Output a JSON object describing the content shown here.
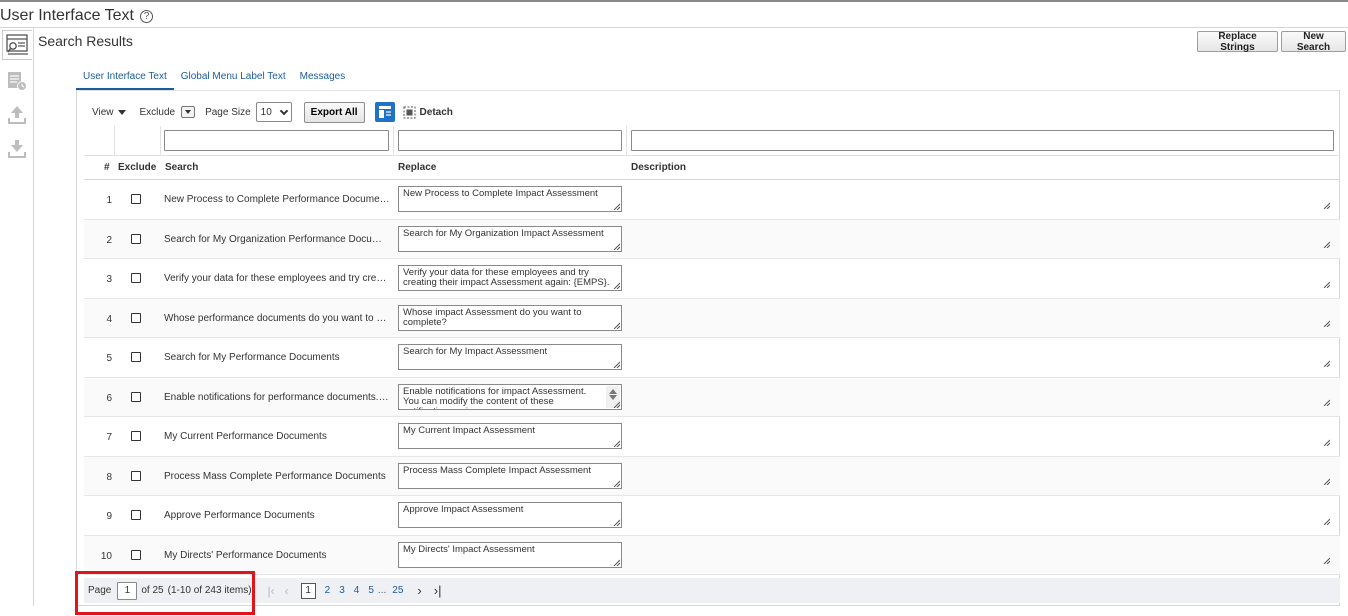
{
  "page": {
    "title": "User Interface Text",
    "section_title": "Search Results"
  },
  "actions": {
    "replace_strings": "Replace Strings",
    "new_search": "New Search"
  },
  "tabs": [
    {
      "label": "User Interface Text",
      "active": true
    },
    {
      "label": "Global Menu Label Text",
      "active": false
    },
    {
      "label": "Messages",
      "active": false
    }
  ],
  "toolbar": {
    "view": "View",
    "exclude": "Exclude",
    "page_size_label": "Page Size",
    "page_size_value": "10",
    "export_all": "Export All",
    "detach": "Detach"
  },
  "columns": {
    "num": "#",
    "exclude": "Exclude",
    "search": "Search",
    "replace": "Replace",
    "description": "Description"
  },
  "rows": [
    {
      "num": "1",
      "search": "New Process to Complete Performance Documents",
      "replace": "New Process to Complete Impact Assessment"
    },
    {
      "num": "2",
      "search": "Search for My Organization Performance Documents",
      "replace": "Search for My Organization Impact Assessment"
    },
    {
      "num": "3",
      "search": "Verify your data for these employees and try creating t...",
      "replace": "Verify your data for these employees and try creating their impact Assessment again: {EMPS}."
    },
    {
      "num": "4",
      "search": "Whose performance documents do you want to compl...",
      "replace": "Whose impact Assessment do you want to complete?"
    },
    {
      "num": "5",
      "search": "Search for My Performance Documents",
      "replace": "Search for My Impact Assessment"
    },
    {
      "num": "6",
      "search": "Enable notifications for performance documents. You ...",
      "replace": "Enable notifications for impact Assessment. You can modify the content of these notifications using"
    },
    {
      "num": "7",
      "search": "My Current Performance Documents",
      "replace": "My Current Impact Assessment"
    },
    {
      "num": "8",
      "search": "Process Mass Complete Performance Documents",
      "replace": "Process Mass Complete Impact Assessment"
    },
    {
      "num": "9",
      "search": "Approve Performance Documents",
      "replace": "Approve Impact Assessment"
    },
    {
      "num": "10",
      "search": "My Directs' Performance Documents",
      "replace": "My Directs' Impact Assessment"
    }
  ],
  "pager": {
    "label": "Page",
    "current": "1",
    "of": "of 25",
    "range": "(1-10 of 243 items)",
    "pages": [
      "1",
      "2",
      "3",
      "4",
      "5"
    ],
    "ellipsis": "...",
    "last_page": "25"
  },
  "colors": {
    "link": "#1a5c9e",
    "accent": "#1e73c8",
    "highlight": "#e0141b"
  }
}
